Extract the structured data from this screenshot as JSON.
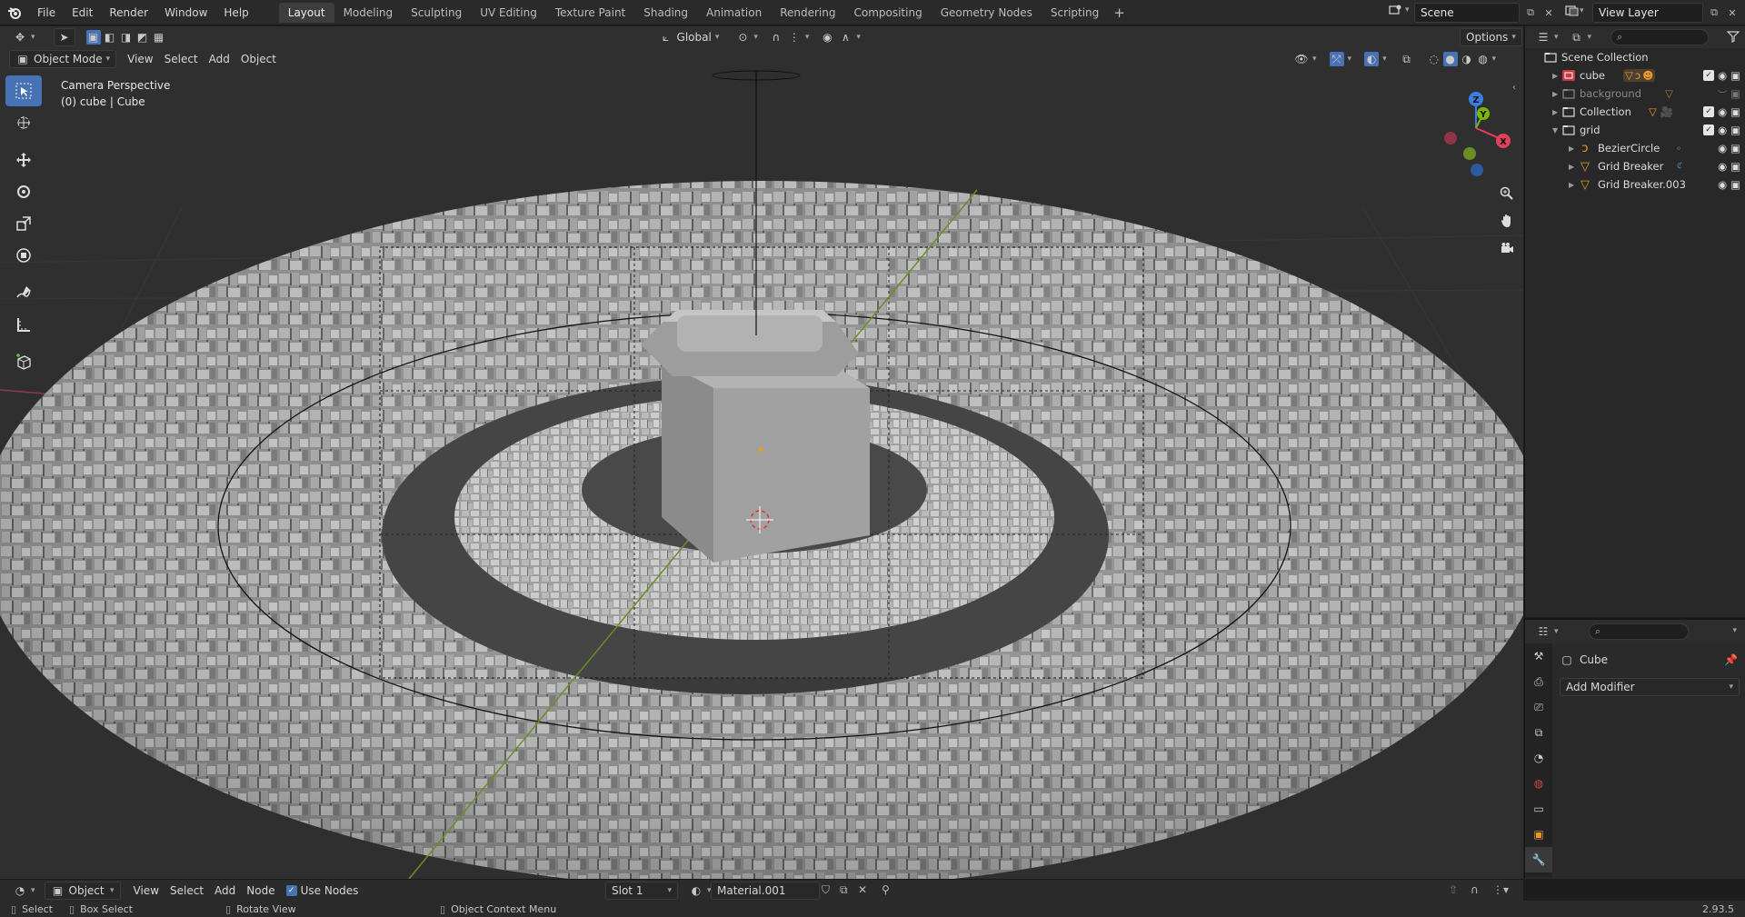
{
  "topbar": {
    "menus": [
      "File",
      "Edit",
      "Render",
      "Window",
      "Help"
    ],
    "workspaces": [
      "Layout",
      "Modeling",
      "Sculpting",
      "UV Editing",
      "Texture Paint",
      "Shading",
      "Animation",
      "Rendering",
      "Compositing",
      "Geometry Nodes",
      "Scripting"
    ],
    "active_workspace": "Layout",
    "scene": "Scene",
    "view_layer": "View Layer"
  },
  "viewport": {
    "mode": "Object Mode",
    "menus": [
      "View",
      "Select",
      "Add",
      "Object"
    ],
    "transform_orientation": "Global",
    "options_label": "Options",
    "info_line1": "Camera Perspective",
    "info_line2": "(0) cube | Cube",
    "gizmo_axes": [
      "Z",
      "Y",
      "X"
    ]
  },
  "outliner": {
    "root": "Scene Collection",
    "items": [
      {
        "label": "cube",
        "depth": 0,
        "expanded": false,
        "type": "collection-red",
        "dim": false
      },
      {
        "label": "background",
        "depth": 0,
        "expanded": false,
        "type": "collection",
        "dim": true
      },
      {
        "label": "Collection",
        "depth": 0,
        "expanded": false,
        "type": "collection",
        "dim": false
      },
      {
        "label": "grid",
        "depth": 0,
        "expanded": true,
        "type": "collection",
        "dim": false
      },
      {
        "label": "BezierCircle",
        "depth": 1,
        "expanded": false,
        "type": "curve",
        "dim": false
      },
      {
        "label": "Grid Breaker",
        "depth": 1,
        "expanded": false,
        "type": "mesh",
        "dim": false
      },
      {
        "label": "Grid Breaker.003",
        "depth": 1,
        "expanded": false,
        "type": "mesh",
        "dim": false
      }
    ]
  },
  "properties": {
    "object_name": "Cube",
    "add_modifier": "Add Modifier"
  },
  "node_header": {
    "editor_mode": "Object",
    "menus": [
      "View",
      "Select",
      "Add",
      "Node"
    ],
    "use_nodes_label": "Use Nodes",
    "use_nodes_checked": true,
    "slot": "Slot 1",
    "material": "Material.001"
  },
  "statusbar": {
    "select": "Select",
    "box_select": "Box Select",
    "rotate_view": "Rotate View",
    "context_menu": "Object Context Menu",
    "version": "2.93.5"
  },
  "colors": {
    "accent": "#4772b3",
    "x_axis": "#e0405a",
    "y_axis": "#7ab800",
    "z_axis": "#3c7ee0"
  }
}
